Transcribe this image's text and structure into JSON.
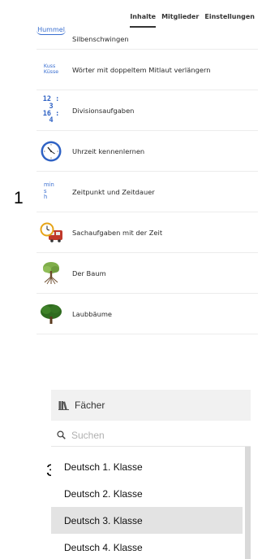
{
  "callouts": {
    "top": "1",
    "bottom": "3"
  },
  "tabs": [
    {
      "label": "Inhalte",
      "active": true
    },
    {
      "label": "Mitglieder",
      "active": false
    },
    {
      "label": "Einstellungen",
      "active": false
    }
  ],
  "content_items": [
    {
      "label": "Silbenschwingen",
      "icon": "hummel-icon",
      "icon_text": "Hummel"
    },
    {
      "label": "Wörter mit doppeltem Mitlaut verlängern",
      "icon": "kuss-kuesse-icon",
      "icon_text_1": "Kuss",
      "icon_text_2": "Küsse"
    },
    {
      "label": "Divisionsaufgaben",
      "icon": "division-icon",
      "icon_text_1": "12 : 3",
      "icon_text_2": "16 : 4"
    },
    {
      "label": "Uhrzeit kennenlernen",
      "icon": "clock-icon"
    },
    {
      "label": "Zeitpunkt und Zeitdauer",
      "icon": "time-units-icon",
      "icon_text_1": "min",
      "icon_text_2": "s",
      "icon_text_3": "h"
    },
    {
      "label": "Sachaufgaben mit der Zeit",
      "icon": "clock-train-icon"
    },
    {
      "label": "Der Baum",
      "icon": "tree-roots-icon"
    },
    {
      "label": "Laubbäume",
      "icon": "deciduous-tree-icon"
    }
  ],
  "faecher": {
    "title": "Fächer",
    "search_placeholder": "Suchen",
    "classes": [
      {
        "label": "Deutsch 1. Klasse",
        "selected": false
      },
      {
        "label": "Deutsch 2. Klasse",
        "selected": false
      },
      {
        "label": "Deutsch 3. Klasse",
        "selected": true
      },
      {
        "label": "Deutsch 4. Klasse",
        "selected": false
      }
    ]
  },
  "colors": {
    "accent_blue": "#3a6fd0",
    "selected_bg": "#e3e3e3",
    "header_bg": "#f1f1f1"
  }
}
